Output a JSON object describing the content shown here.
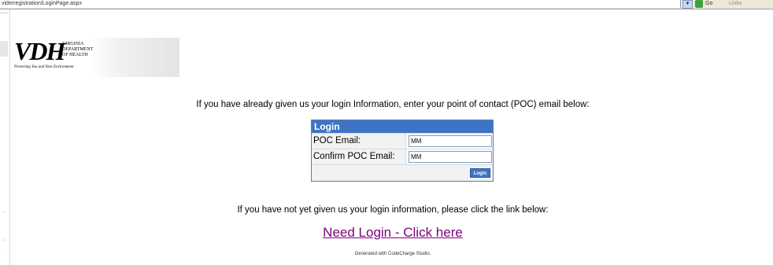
{
  "browser": {
    "address_url": "viderregistration/LoginPage.aspx",
    "go_label": "Go",
    "links_label": "Links"
  },
  "logo": {
    "text": "VDH",
    "dept_line1": "VIRGINIA",
    "dept_line2": "DEPARTMENT",
    "dept_line3": "OF HEALTH",
    "tagline": "Protecting You and Your Environment"
  },
  "intro_text": "If you have already given us your login Information, enter your point of contact (POC) email below:",
  "login_form": {
    "title": "Login",
    "poc_email_label": "POC Email:",
    "poc_email_value": "MM",
    "confirm_label": "Confirm POC Email:",
    "confirm_value": "MM",
    "login_button": "Login"
  },
  "no_login_text": "If you have not yet given us your login information, please click the link below:",
  "need_login_link": "Need Login - Click here",
  "generated_text": "Generated with CodeCharge Studio.",
  "colors": {
    "form_header": "#3f74c4",
    "link_visited": "#800080"
  }
}
